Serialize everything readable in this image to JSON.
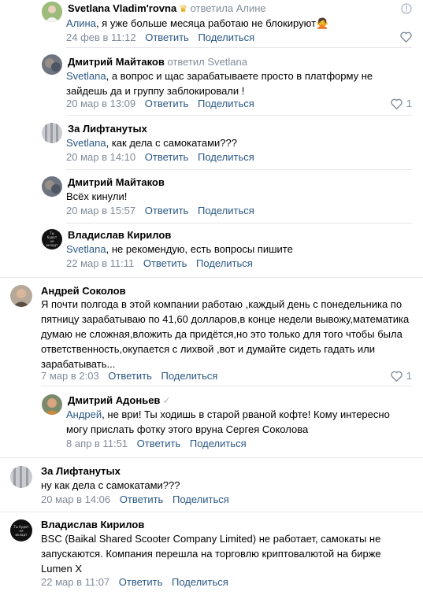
{
  "actions": {
    "reply": "Ответить",
    "share": "Поделиться"
  },
  "comments": [
    {
      "author": "Svetlana Vladim'rovna",
      "replied": "ответила Алине",
      "mention": "Алина",
      "text": ", я уже больше месяца работаю не блокируют",
      "date": "24 фев в 11:12"
    },
    {
      "author": "Дмитрий Майтаков",
      "replied": "ответил Svetlana",
      "mention": "Svetlana",
      "text": ", а вопрос и щас зарабатываете просто в платформу не зайдешь да и группу заблокировали !",
      "date": "20 мар в 13:09",
      "likes": "1"
    },
    {
      "author": "За Лифтанутых",
      "mention": "Svetlana",
      "text": ", как дела с самокатами???",
      "date": "20 мар в 14:10"
    },
    {
      "author": "Дмитрий Майтаков",
      "text": "Всёх кинули!",
      "date": "20 мар в 15:57"
    },
    {
      "author": "Владислав Кирилов",
      "mention": "Svetlana",
      "text": ", не рекомендую, есть вопросы пишите",
      "date": "22 мар в 11:11"
    },
    {
      "author": "Андрей Соколов",
      "text": "Я почти полгода в этой компании работаю ,каждый день с понедельника по пятницу зарабатываю по 41,60 долларов,в конце недели вывожу,математика думаю не сложная,вложить да придётся,но это только для того чтобы была ответственность,окупается с лихвой ,вот и думайте сидеть гадать или зарабатывать...",
      "date": "7 мар в 2:03",
      "likes": "1"
    },
    {
      "author": "Дмитрий Адоньев",
      "mention": "Андрей",
      "text": ", не ври! Ты ходишь в старой рваной кофте! Кому интересно могу прислать фотку этого вруна Сергея Соколова",
      "date": "8 апр в 11:51"
    },
    {
      "author": "За Лифтанутых",
      "text": "ну как дела с самокатами???",
      "date": "20 мар в 14:06"
    },
    {
      "author": "Владислав Кирилов",
      "text": "BSC (Baikal Shared Scooter Company Limited) не работает, самокаты не запускаются. Компания перешла на торговлю криптовалютой на бирже Lumen X",
      "date": "22 мар в 11:07"
    }
  ],
  "avatar_logo_text": "Ты будет не вкладт",
  "colors": {
    "link": "#2a5885",
    "secondary": "#818c99",
    "separator": "#e7e8ec"
  }
}
